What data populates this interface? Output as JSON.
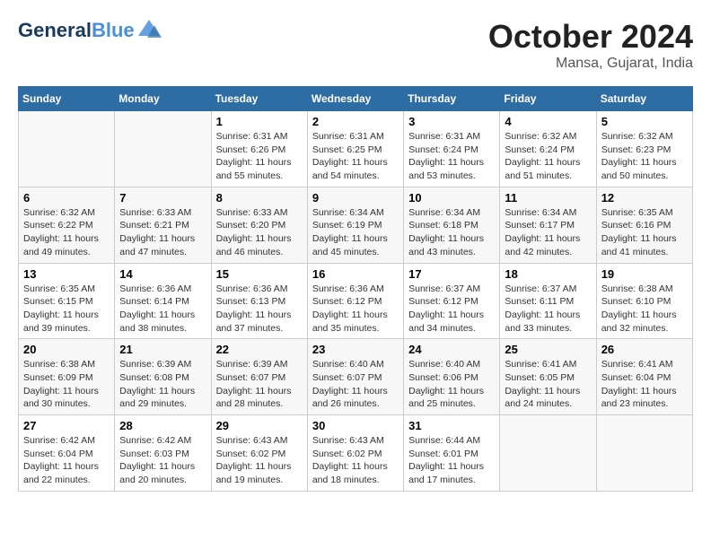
{
  "header": {
    "logo_line1": "General",
    "logo_line2": "Blue",
    "month_title": "October 2024",
    "subtitle": "Mansa, Gujarat, India"
  },
  "weekdays": [
    "Sunday",
    "Monday",
    "Tuesday",
    "Wednesday",
    "Thursday",
    "Friday",
    "Saturday"
  ],
  "weeks": [
    [
      {
        "day": "",
        "sunrise": "",
        "sunset": "",
        "daylight": ""
      },
      {
        "day": "",
        "sunrise": "",
        "sunset": "",
        "daylight": ""
      },
      {
        "day": "1",
        "sunrise": "Sunrise: 6:31 AM",
        "sunset": "Sunset: 6:26 PM",
        "daylight": "Daylight: 11 hours and 55 minutes."
      },
      {
        "day": "2",
        "sunrise": "Sunrise: 6:31 AM",
        "sunset": "Sunset: 6:25 PM",
        "daylight": "Daylight: 11 hours and 54 minutes."
      },
      {
        "day": "3",
        "sunrise": "Sunrise: 6:31 AM",
        "sunset": "Sunset: 6:24 PM",
        "daylight": "Daylight: 11 hours and 53 minutes."
      },
      {
        "day": "4",
        "sunrise": "Sunrise: 6:32 AM",
        "sunset": "Sunset: 6:24 PM",
        "daylight": "Daylight: 11 hours and 51 minutes."
      },
      {
        "day": "5",
        "sunrise": "Sunrise: 6:32 AM",
        "sunset": "Sunset: 6:23 PM",
        "daylight": "Daylight: 11 hours and 50 minutes."
      }
    ],
    [
      {
        "day": "6",
        "sunrise": "Sunrise: 6:32 AM",
        "sunset": "Sunset: 6:22 PM",
        "daylight": "Daylight: 11 hours and 49 minutes."
      },
      {
        "day": "7",
        "sunrise": "Sunrise: 6:33 AM",
        "sunset": "Sunset: 6:21 PM",
        "daylight": "Daylight: 11 hours and 47 minutes."
      },
      {
        "day": "8",
        "sunrise": "Sunrise: 6:33 AM",
        "sunset": "Sunset: 6:20 PM",
        "daylight": "Daylight: 11 hours and 46 minutes."
      },
      {
        "day": "9",
        "sunrise": "Sunrise: 6:34 AM",
        "sunset": "Sunset: 6:19 PM",
        "daylight": "Daylight: 11 hours and 45 minutes."
      },
      {
        "day": "10",
        "sunrise": "Sunrise: 6:34 AM",
        "sunset": "Sunset: 6:18 PM",
        "daylight": "Daylight: 11 hours and 43 minutes."
      },
      {
        "day": "11",
        "sunrise": "Sunrise: 6:34 AM",
        "sunset": "Sunset: 6:17 PM",
        "daylight": "Daylight: 11 hours and 42 minutes."
      },
      {
        "day": "12",
        "sunrise": "Sunrise: 6:35 AM",
        "sunset": "Sunset: 6:16 PM",
        "daylight": "Daylight: 11 hours and 41 minutes."
      }
    ],
    [
      {
        "day": "13",
        "sunrise": "Sunrise: 6:35 AM",
        "sunset": "Sunset: 6:15 PM",
        "daylight": "Daylight: 11 hours and 39 minutes."
      },
      {
        "day": "14",
        "sunrise": "Sunrise: 6:36 AM",
        "sunset": "Sunset: 6:14 PM",
        "daylight": "Daylight: 11 hours and 38 minutes."
      },
      {
        "day": "15",
        "sunrise": "Sunrise: 6:36 AM",
        "sunset": "Sunset: 6:13 PM",
        "daylight": "Daylight: 11 hours and 37 minutes."
      },
      {
        "day": "16",
        "sunrise": "Sunrise: 6:36 AM",
        "sunset": "Sunset: 6:12 PM",
        "daylight": "Daylight: 11 hours and 35 minutes."
      },
      {
        "day": "17",
        "sunrise": "Sunrise: 6:37 AM",
        "sunset": "Sunset: 6:12 PM",
        "daylight": "Daylight: 11 hours and 34 minutes."
      },
      {
        "day": "18",
        "sunrise": "Sunrise: 6:37 AM",
        "sunset": "Sunset: 6:11 PM",
        "daylight": "Daylight: 11 hours and 33 minutes."
      },
      {
        "day": "19",
        "sunrise": "Sunrise: 6:38 AM",
        "sunset": "Sunset: 6:10 PM",
        "daylight": "Daylight: 11 hours and 32 minutes."
      }
    ],
    [
      {
        "day": "20",
        "sunrise": "Sunrise: 6:38 AM",
        "sunset": "Sunset: 6:09 PM",
        "daylight": "Daylight: 11 hours and 30 minutes."
      },
      {
        "day": "21",
        "sunrise": "Sunrise: 6:39 AM",
        "sunset": "Sunset: 6:08 PM",
        "daylight": "Daylight: 11 hours and 29 minutes."
      },
      {
        "day": "22",
        "sunrise": "Sunrise: 6:39 AM",
        "sunset": "Sunset: 6:07 PM",
        "daylight": "Daylight: 11 hours and 28 minutes."
      },
      {
        "day": "23",
        "sunrise": "Sunrise: 6:40 AM",
        "sunset": "Sunset: 6:07 PM",
        "daylight": "Daylight: 11 hours and 26 minutes."
      },
      {
        "day": "24",
        "sunrise": "Sunrise: 6:40 AM",
        "sunset": "Sunset: 6:06 PM",
        "daylight": "Daylight: 11 hours and 25 minutes."
      },
      {
        "day": "25",
        "sunrise": "Sunrise: 6:41 AM",
        "sunset": "Sunset: 6:05 PM",
        "daylight": "Daylight: 11 hours and 24 minutes."
      },
      {
        "day": "26",
        "sunrise": "Sunrise: 6:41 AM",
        "sunset": "Sunset: 6:04 PM",
        "daylight": "Daylight: 11 hours and 23 minutes."
      }
    ],
    [
      {
        "day": "27",
        "sunrise": "Sunrise: 6:42 AM",
        "sunset": "Sunset: 6:04 PM",
        "daylight": "Daylight: 11 hours and 22 minutes."
      },
      {
        "day": "28",
        "sunrise": "Sunrise: 6:42 AM",
        "sunset": "Sunset: 6:03 PM",
        "daylight": "Daylight: 11 hours and 20 minutes."
      },
      {
        "day": "29",
        "sunrise": "Sunrise: 6:43 AM",
        "sunset": "Sunset: 6:02 PM",
        "daylight": "Daylight: 11 hours and 19 minutes."
      },
      {
        "day": "30",
        "sunrise": "Sunrise: 6:43 AM",
        "sunset": "Sunset: 6:02 PM",
        "daylight": "Daylight: 11 hours and 18 minutes."
      },
      {
        "day": "31",
        "sunrise": "Sunrise: 6:44 AM",
        "sunset": "Sunset: 6:01 PM",
        "daylight": "Daylight: 11 hours and 17 minutes."
      },
      {
        "day": "",
        "sunrise": "",
        "sunset": "",
        "daylight": ""
      },
      {
        "day": "",
        "sunrise": "",
        "sunset": "",
        "daylight": ""
      }
    ]
  ]
}
